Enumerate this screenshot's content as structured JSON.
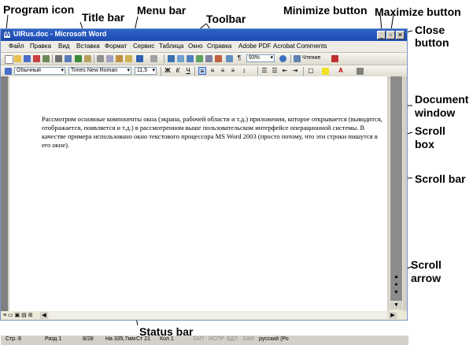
{
  "window": {
    "title": "UIRus.doc - Microsoft Word",
    "app_icon_letter": "W",
    "minimize_glyph": "_",
    "maximize_glyph": "▫",
    "close_glyph": "✕"
  },
  "menu": {
    "items": [
      "Файл",
      "Правка",
      "Вид",
      "Вставка",
      "Формат",
      "Сервис",
      "Таблица",
      "Окно",
      "Справка",
      "Adobe PDF",
      "Acrobat Comments"
    ]
  },
  "toolbar": {
    "zoom": "93%",
    "reading_button": "Чтение"
  },
  "formatting": {
    "style": "Обычный",
    "font": "Times New Roman",
    "size": "11,5",
    "bold": "Ж",
    "italic": "К",
    "underline": "Ч"
  },
  "document": {
    "text": "Рассмотрим основные компоненты окна (экрана, рабочей области и т.д.) приложения, которое открывается (выводится, отображается, появляется и т.д.) в рассмотренном выше пользовательском интерфейсе операционной системы. В качестве примера использовано окно текстового процессора MS Word 2003 (просто потому, что эти строки пишутся в его окне)."
  },
  "status": {
    "page": "Стр. 8",
    "section": "Разд 1",
    "pages": "8/28",
    "position": "На 335,7мм",
    "line": "Ст 21",
    "column": "Кол 1",
    "rec": "ЗАП",
    "trk": "ИСПР",
    "ext": "ВДЛ",
    "ovr": "ЗАМ",
    "language": "русский (Ро"
  },
  "labels": {
    "program_icon": "Program icon",
    "title_bar": "Title bar",
    "menu_bar": "Menu bar",
    "toolbar": "Toolbar",
    "minimize_button": "Minimize button",
    "maximize_button": "Maximize button",
    "close_button": "Close button",
    "document_window": "Document window",
    "scroll_box": "Scroll box",
    "scroll_bar": "Scroll bar",
    "scroll_arrow": "Scroll arrow",
    "status_bar": "Status bar"
  },
  "colors": {
    "title_bar": "#1c4ab0",
    "window_chrome": "#d4d0c8",
    "scroll_thumb": "#8c8c8c",
    "left_margin": "#808080"
  }
}
